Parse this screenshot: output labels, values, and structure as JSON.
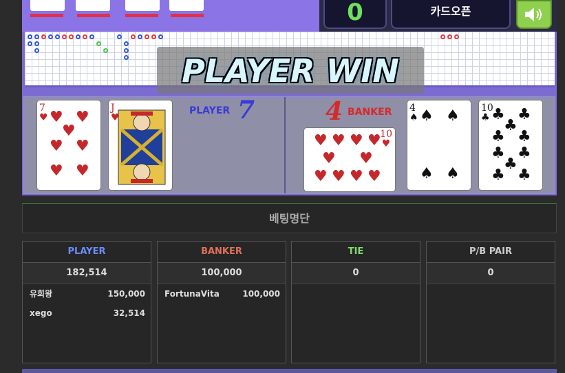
{
  "top": {
    "score": "0",
    "card_open_label": "카드오픈",
    "sound_icon": "speaker-icon"
  },
  "result_banner": "PLAYER WIN",
  "player": {
    "label": "PLAYER",
    "score": "7",
    "cards": [
      {
        "rank": "7",
        "suit": "hearts"
      },
      {
        "rank": "J",
        "suit": "hearts"
      }
    ]
  },
  "banker": {
    "label": "BANKER",
    "score": "4",
    "cards": [
      {
        "rank": "10",
        "suit": "hearts"
      },
      {
        "rank": "4",
        "suit": "spades"
      },
      {
        "rank": "10",
        "suit": "clubs"
      }
    ]
  },
  "betting_list": {
    "title": "베팅명단",
    "columns": [
      {
        "label": "PLAYER",
        "color": "#6b8cff",
        "total": "182,514",
        "bets": [
          {
            "name": "유희왕",
            "amount": "150,000"
          },
          {
            "name": "xego",
            "amount": "32,514"
          }
        ]
      },
      {
        "label": "BANKER",
        "color": "#e0705a",
        "total": "100,000",
        "bets": [
          {
            "name": "FortunaVita",
            "amount": "100,000"
          }
        ]
      },
      {
        "label": "TIE",
        "color": "#7ddc6a",
        "total": "0",
        "bets": []
      },
      {
        "label": "P/B PAIR",
        "color": "#cccccc",
        "total": "0",
        "bets": []
      }
    ]
  }
}
